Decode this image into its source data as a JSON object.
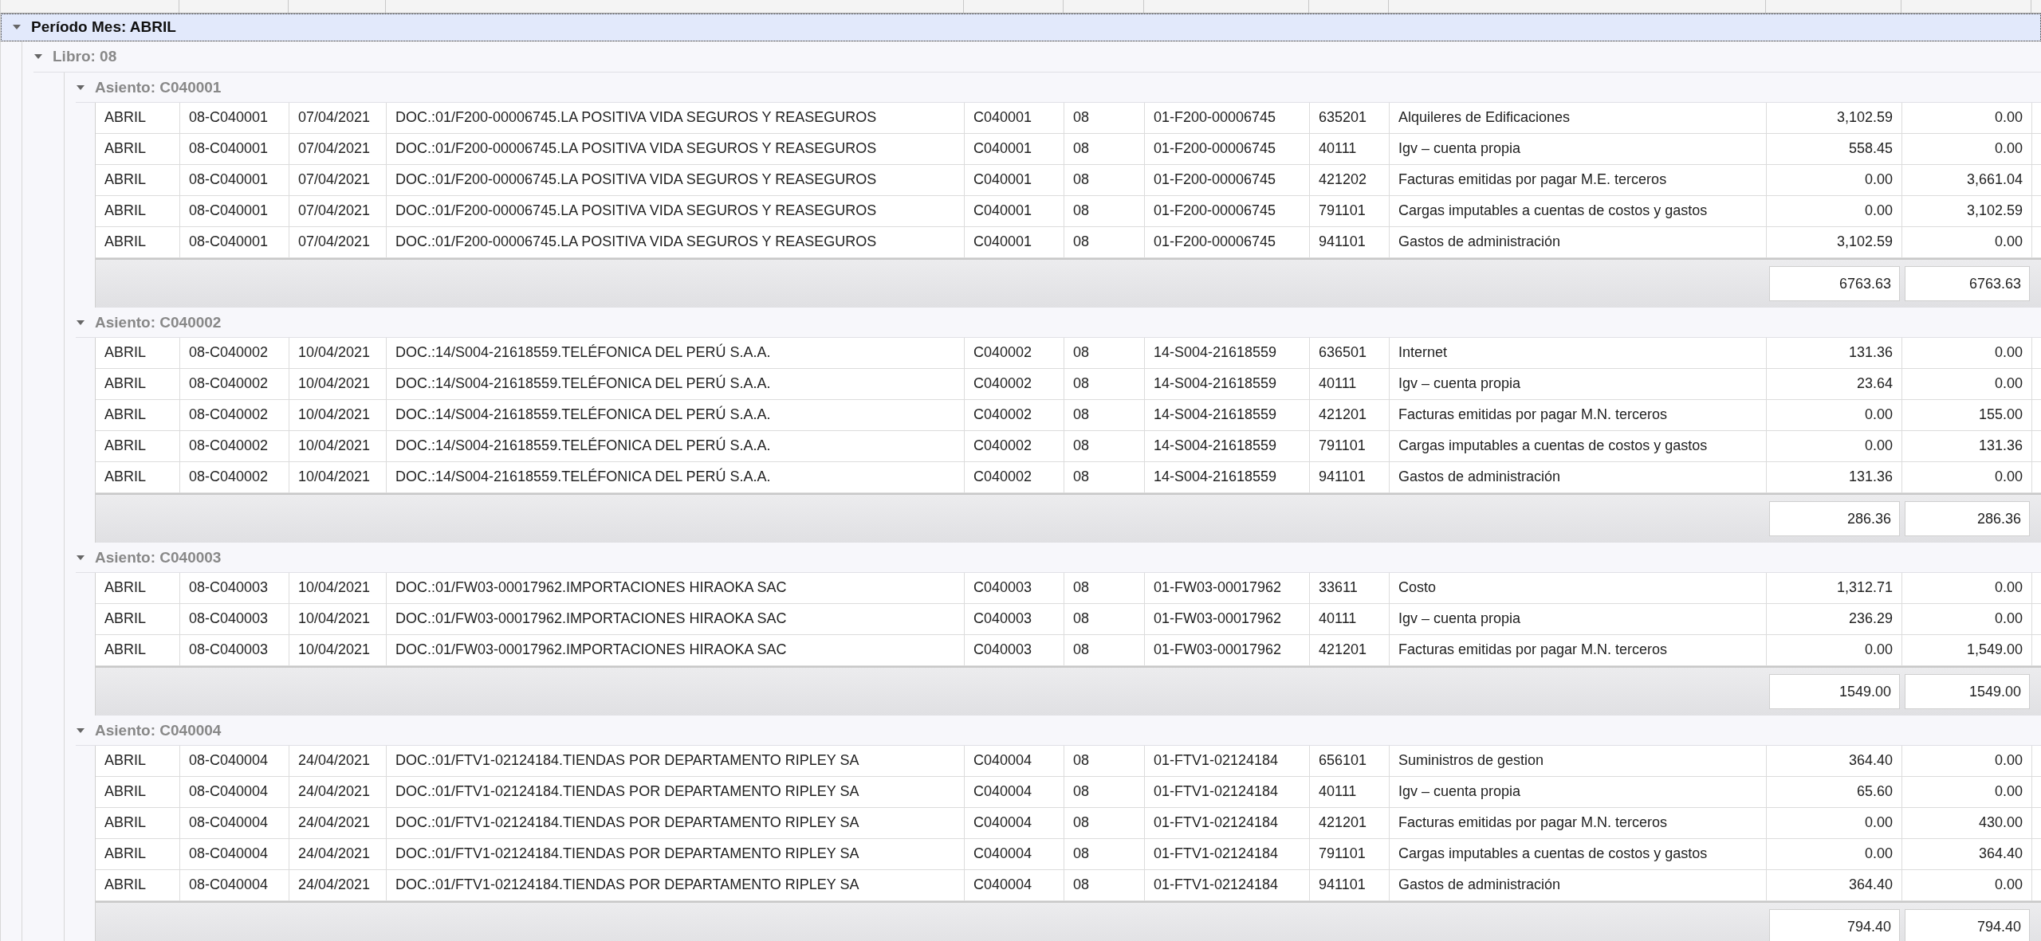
{
  "period": {
    "label": "Período Mes: ABRIL",
    "expanded": true,
    "selected": true,
    "libros": [
      {
        "label": "Libro: 08",
        "expanded": true,
        "asientos": [
          {
            "label": "Asiento: C040001",
            "expanded": true,
            "rows": [
              [
                "ABRIL",
                "08-C040001",
                "07/04/2021",
                "DOC.:01/F200-00006745.LA POSITIVA VIDA SEGUROS Y REASEGUROS",
                "C040001",
                "08",
                "01-F200-00006745",
                "635201",
                "Alquileres de Edificaciones",
                "3,102.59",
                "0.00"
              ],
              [
                "ABRIL",
                "08-C040001",
                "07/04/2021",
                "DOC.:01/F200-00006745.LA POSITIVA VIDA SEGUROS Y REASEGUROS",
                "C040001",
                "08",
                "01-F200-00006745",
                "40111",
                "Igv – cuenta propia",
                "558.45",
                "0.00"
              ],
              [
                "ABRIL",
                "08-C040001",
                "07/04/2021",
                "DOC.:01/F200-00006745.LA POSITIVA VIDA SEGUROS Y REASEGUROS",
                "C040001",
                "08",
                "01-F200-00006745",
                "421202",
                "Facturas emitidas por pagar  M.E. terceros",
                "0.00",
                "3,661.04"
              ],
              [
                "ABRIL",
                "08-C040001",
                "07/04/2021",
                "DOC.:01/F200-00006745.LA POSITIVA VIDA SEGUROS Y REASEGUROS",
                "C040001",
                "08",
                "01-F200-00006745",
                "791101",
                "Cargas imputables a cuentas de costos y gastos",
                "0.00",
                "3,102.59"
              ],
              [
                "ABRIL",
                "08-C040001",
                "07/04/2021",
                "DOC.:01/F200-00006745.LA POSITIVA VIDA SEGUROS Y REASEGUROS",
                "C040001",
                "08",
                "01-F200-00006745",
                "941101",
                "Gastos de administración",
                "3,102.59",
                "0.00"
              ]
            ],
            "totals": [
              "6763.63",
              "6763.63"
            ]
          },
          {
            "label": "Asiento: C040002",
            "expanded": true,
            "rows": [
              [
                "ABRIL",
                "08-C040002",
                "10/04/2021",
                "DOC.:14/S004-21618559.TELÉFONICA DEL PERÚ S.A.A.",
                "C040002",
                "08",
                "14-S004-21618559",
                "636501",
                "Internet",
                "131.36",
                "0.00"
              ],
              [
                "ABRIL",
                "08-C040002",
                "10/04/2021",
                "DOC.:14/S004-21618559.TELÉFONICA DEL PERÚ S.A.A.",
                "C040002",
                "08",
                "14-S004-21618559",
                "40111",
                "Igv – cuenta propia",
                "23.64",
                "0.00"
              ],
              [
                "ABRIL",
                "08-C040002",
                "10/04/2021",
                "DOC.:14/S004-21618559.TELÉFONICA DEL PERÚ S.A.A.",
                "C040002",
                "08",
                "14-S004-21618559",
                "421201",
                "Facturas emitidas por pagar  M.N. terceros",
                "0.00",
                "155.00"
              ],
              [
                "ABRIL",
                "08-C040002",
                "10/04/2021",
                "DOC.:14/S004-21618559.TELÉFONICA DEL PERÚ S.A.A.",
                "C040002",
                "08",
                "14-S004-21618559",
                "791101",
                "Cargas imputables a cuentas de costos y gastos",
                "0.00",
                "131.36"
              ],
              [
                "ABRIL",
                "08-C040002",
                "10/04/2021",
                "DOC.:14/S004-21618559.TELÉFONICA DEL PERÚ S.A.A.",
                "C040002",
                "08",
                "14-S004-21618559",
                "941101",
                "Gastos de administración",
                "131.36",
                "0.00"
              ]
            ],
            "totals": [
              "286.36",
              "286.36"
            ]
          },
          {
            "label": "Asiento: C040003",
            "expanded": true,
            "rows": [
              [
                "ABRIL",
                "08-C040003",
                "10/04/2021",
                "DOC.:01/FW03-00017962.IMPORTACIONES HIRAOKA SAC",
                "C040003",
                "08",
                "01-FW03-00017962",
                "33611",
                "Costo",
                "1,312.71",
                "0.00"
              ],
              [
                "ABRIL",
                "08-C040003",
                "10/04/2021",
                "DOC.:01/FW03-00017962.IMPORTACIONES HIRAOKA SAC",
                "C040003",
                "08",
                "01-FW03-00017962",
                "40111",
                "Igv – cuenta propia",
                "236.29",
                "0.00"
              ],
              [
                "ABRIL",
                "08-C040003",
                "10/04/2021",
                "DOC.:01/FW03-00017962.IMPORTACIONES HIRAOKA SAC",
                "C040003",
                "08",
                "01-FW03-00017962",
                "421201",
                "Facturas emitidas por pagar  M.N. terceros",
                "0.00",
                "1,549.00"
              ]
            ],
            "totals": [
              "1549.00",
              "1549.00"
            ]
          },
          {
            "label": "Asiento: C040004",
            "expanded": true,
            "rows": [
              [
                "ABRIL",
                "08-C040004",
                "24/04/2021",
                "DOC.:01/FTV1-02124184.TIENDAS POR DEPARTAMENTO RIPLEY SA",
                "C040004",
                "08",
                "01-FTV1-02124184",
                "656101",
                "Suministros de gestion",
                "364.40",
                "0.00"
              ],
              [
                "ABRIL",
                "08-C040004",
                "24/04/2021",
                "DOC.:01/FTV1-02124184.TIENDAS POR DEPARTAMENTO RIPLEY SA",
                "C040004",
                "08",
                "01-FTV1-02124184",
                "40111",
                "Igv – cuenta propia",
                "65.60",
                "0.00"
              ],
              [
                "ABRIL",
                "08-C040004",
                "24/04/2021",
                "DOC.:01/FTV1-02124184.TIENDAS POR DEPARTAMENTO RIPLEY SA",
                "C040004",
                "08",
                "01-FTV1-02124184",
                "421201",
                "Facturas emitidas por pagar  M.N. terceros",
                "0.00",
                "430.00"
              ],
              [
                "ABRIL",
                "08-C040004",
                "24/04/2021",
                "DOC.:01/FTV1-02124184.TIENDAS POR DEPARTAMENTO RIPLEY SA",
                "C040004",
                "08",
                "01-FTV1-02124184",
                "791101",
                "Cargas imputables a cuentas de costos y gastos",
                "0.00",
                "364.40"
              ],
              [
                "ABRIL",
                "08-C040004",
                "24/04/2021",
                "DOC.:01/FTV1-02124184.TIENDAS POR DEPARTAMENTO RIPLEY SA",
                "C040004",
                "08",
                "01-FTV1-02124184",
                "941101",
                "Gastos de administración",
                "364.40",
                "0.00"
              ]
            ],
            "totals": [
              "794.40",
              "794.40"
            ]
          }
        ]
      }
    ]
  }
}
